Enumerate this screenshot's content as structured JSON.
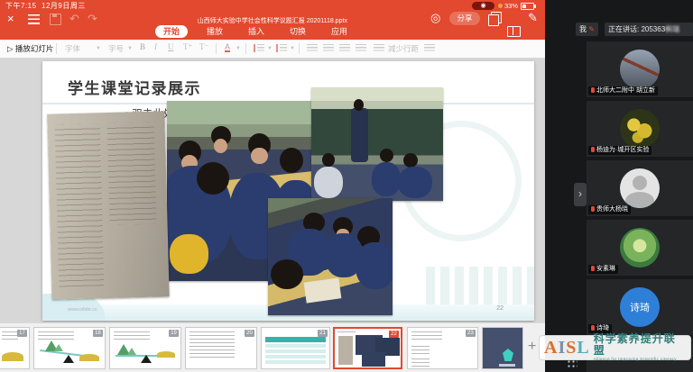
{
  "status_bar": {
    "time": "下午7:15",
    "date": "12月9日周三",
    "battery": "33%"
  },
  "title_bar": {
    "filename": "山西师大实验中学社会性科学议题汇报 20201118.pptx",
    "share": "分享"
  },
  "tabs": [
    {
      "label": "开始"
    },
    {
      "label": "播放"
    },
    {
      "label": "插入"
    },
    {
      "label": "切换"
    },
    {
      "label": "应用"
    }
  ],
  "toolbar": {
    "play": "播放幻灯片",
    "font": "字体",
    "size": "字号",
    "bold": "B",
    "italic": "I",
    "underline": "U",
    "grow": "T⁺",
    "shrink": "T⁻",
    "color": "A",
    "spacing": "减少行距"
  },
  "slide": {
    "title": "学生课堂记录展示",
    "bullet": "• 双击此处添加文本",
    "watermark": "www.islide.cc",
    "page": "22"
  },
  "filmstrip": [
    {
      "num": "17"
    },
    {
      "num": "18"
    },
    {
      "num": "19"
    },
    {
      "num": "20"
    },
    {
      "num": "21"
    },
    {
      "num": "22"
    },
    {
      "num": "23"
    },
    {
      "num": ""
    }
  ],
  "meeting": {
    "me": "我",
    "speaking_prefix": "正在讲话: 205363",
    "speaking_name": "枫瑞",
    "participants": [
      {
        "name": "北师大二附中 胡立新",
        "avatar": "bridge-photo"
      },
      {
        "name": "杨迪为·城开区实验",
        "avatar": "yellow-flowers"
      },
      {
        "name": "贵师大杨晓",
        "avatar": "default-person"
      },
      {
        "name": "安素琳",
        "avatar": "green-landscape"
      },
      {
        "name": "诗琦",
        "initials": "诗琦",
        "avatar": "blue-initials"
      }
    ]
  },
  "logo": {
    "letters": [
      {
        "ch": "A",
        "color": "#d9702c"
      },
      {
        "ch": "I",
        "color": "#7b8fa7"
      },
      {
        "ch": "S",
        "color": "#d9702c"
      },
      {
        "ch": "L",
        "color": "#54aebe"
      }
    ],
    "cn": "科学素养提升联盟",
    "en": "Alliance for Improving Scientific Literacy"
  },
  "colors": {
    "app_orange": "#e2492e",
    "sidebar_bg": "#17181a",
    "selected_badge": "#e2492e",
    "logo_teal": "#2f7e7b",
    "avatar_blue": "#2e7fd8"
  }
}
